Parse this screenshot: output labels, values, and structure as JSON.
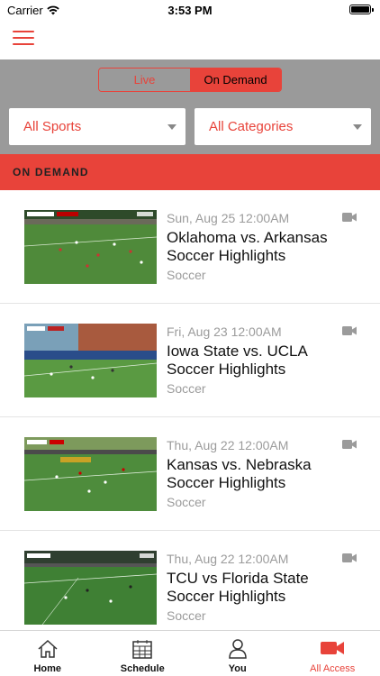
{
  "status_bar": {
    "carrier": "Carrier",
    "time": "3:53 PM"
  },
  "segmented": {
    "live_label": "Live",
    "on_demand_label": "On Demand",
    "selected": "On Demand"
  },
  "filters": {
    "sports_value": "All Sports",
    "categories_value": "All Categories"
  },
  "section": {
    "title": "ON DEMAND"
  },
  "items": [
    {
      "date": "Sun, Aug 25 12:00AM",
      "title": "Oklahoma vs. Arkansas Soccer Highlights",
      "sport": "Soccer",
      "icon": "video-camera-icon"
    },
    {
      "date": "Fri, Aug 23 12:00AM",
      "title": "Iowa State vs. UCLA Soccer Highlights",
      "sport": "Soccer",
      "icon": "video-camera-icon"
    },
    {
      "date": "Thu, Aug 22 12:00AM",
      "title": "Kansas vs. Nebraska Soccer Highlights",
      "sport": "Soccer",
      "icon": "video-camera-icon"
    },
    {
      "date": "Thu, Aug 22 12:00AM",
      "title": "TCU vs Florida State Soccer Highlights",
      "sport": "Soccer",
      "icon": "video-camera-icon"
    }
  ],
  "tabs": [
    {
      "label": "Home",
      "icon": "home-icon"
    },
    {
      "label": "Schedule",
      "icon": "calendar-icon"
    },
    {
      "label": "You",
      "icon": "person-icon"
    },
    {
      "label": "All Access",
      "icon": "video-camera-icon",
      "active": true
    }
  ],
  "colors": {
    "accent": "#e8433a",
    "filter_bg": "#9a9a9a",
    "muted_text": "#9b9b9b"
  }
}
